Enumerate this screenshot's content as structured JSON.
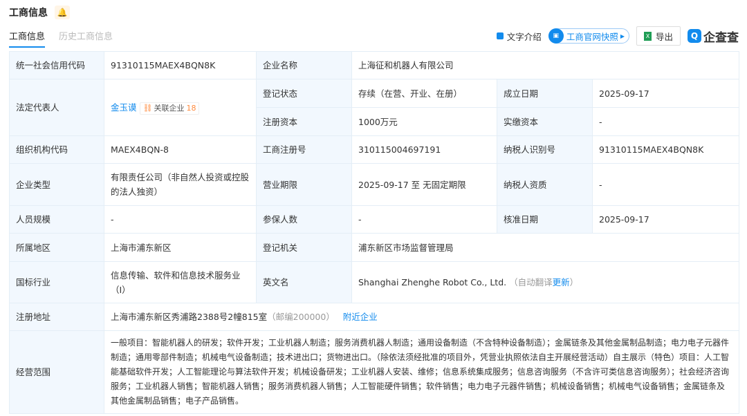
{
  "header": {
    "title": "工商信息",
    "tabs": [
      "工商信息",
      "历史工商信息"
    ]
  },
  "toolbar": {
    "intro": "文字介绍",
    "snapshot": "工商官网快照",
    "export": "导出",
    "logo": "企查查"
  },
  "rows": {
    "credit_code_label": "统一社会信用代码",
    "credit_code": "91310115MAEX4BQN8K",
    "name_label": "企业名称",
    "name": "上海征和机器人有限公司",
    "legal_label": "法定代表人",
    "legal": "金玉谟",
    "related_label": "关联企业",
    "related_count": "18",
    "status_label": "登记状态",
    "status": "存续（在营、开业、在册）",
    "found_label": "成立日期",
    "found": "2025-09-17",
    "capital_label": "注册资本",
    "capital": "1000万元",
    "paid_label": "实缴资本",
    "paid": "-",
    "org_label": "组织机构代码",
    "org": "MAEX4BQN-8",
    "regno_label": "工商注册号",
    "regno": "310115004697191",
    "taxid_label": "纳税人识别号",
    "taxid": "91310115MAEX4BQN8K",
    "type_label": "企业类型",
    "type": "有限责任公司（非自然人投资或控股的法人独资）",
    "term_label": "营业期限",
    "term": "2025-09-17 至 无固定期限",
    "taxq_label": "纳税人资质",
    "taxq": "-",
    "staff_label": "人员规模",
    "staff": "-",
    "insured_label": "参保人数",
    "insured": "-",
    "approve_label": "核准日期",
    "approve": "2025-09-17",
    "region_label": "所属地区",
    "region": "上海市浦东新区",
    "authority_label": "登记机关",
    "authority": "浦东新区市场监督管理局",
    "industry_label": "国标行业",
    "industry": "信息传输、软件和信息技术服务业（I）",
    "en_label": "英文名",
    "en": "Shanghai Zhenghe Robot Co., Ltd.",
    "en_auto": "（自动翻译",
    "en_update": "更新",
    "en_close": "）",
    "addr_label": "注册地址",
    "addr": "上海市浦东新区秀浦路2388号2幢815室",
    "zip": "（邮编200000）",
    "nearby": "附近企业",
    "scope_label": "经营范围",
    "scope": "一般项目：智能机器人的研发；软件开发；工业机器人制造；服务消费机器人制造；通用设备制造（不含特种设备制造）；金属链条及其他金属制品制造；电力电子元器件制造；通用零部件制造；机械电气设备制造；技术进出口；货物进出口。（除依法须经批准的项目外，凭营业执照依法自主开展经营活动）自主展示（特色）项目：人工智能基础软件开发；人工智能理论与算法软件开发；机械设备研发；工业机器人安装、维修；信息系统集成服务；信息咨询服务（不含许可类信息咨询服务）；社会经济咨询服务；工业机器人销售；智能机器人销售；服务消费机器人销售；人工智能硬件销售；软件销售；电力电子元器件销售；机械设备销售；机械电气设备销售；金属链条及其他金属制品销售；电子产品销售。"
  }
}
